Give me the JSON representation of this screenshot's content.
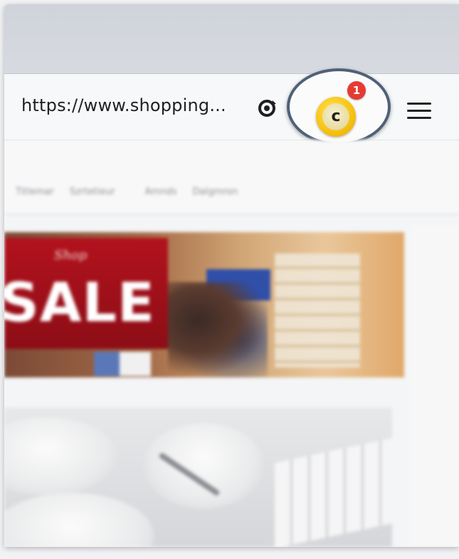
{
  "browser": {
    "url": "https://www.shopping...",
    "extension_icon": "circle-arrow-icon",
    "coupon_extension": {
      "letter": "c",
      "badge_count": "1"
    },
    "menu_icon": "hamburger-menu-icon"
  },
  "site": {
    "nav": [
      "Titlemar",
      "Szrtetieur",
      "Amnds",
      "Dalgmron"
    ],
    "hero": {
      "script_text": "Shop",
      "sale_text": "SALE"
    }
  },
  "colors": {
    "coupon_gold": "#f7c413",
    "badge_red": "#e43c33",
    "spotlight_ring": "#4f6178",
    "sale_red": "#b2121d"
  }
}
